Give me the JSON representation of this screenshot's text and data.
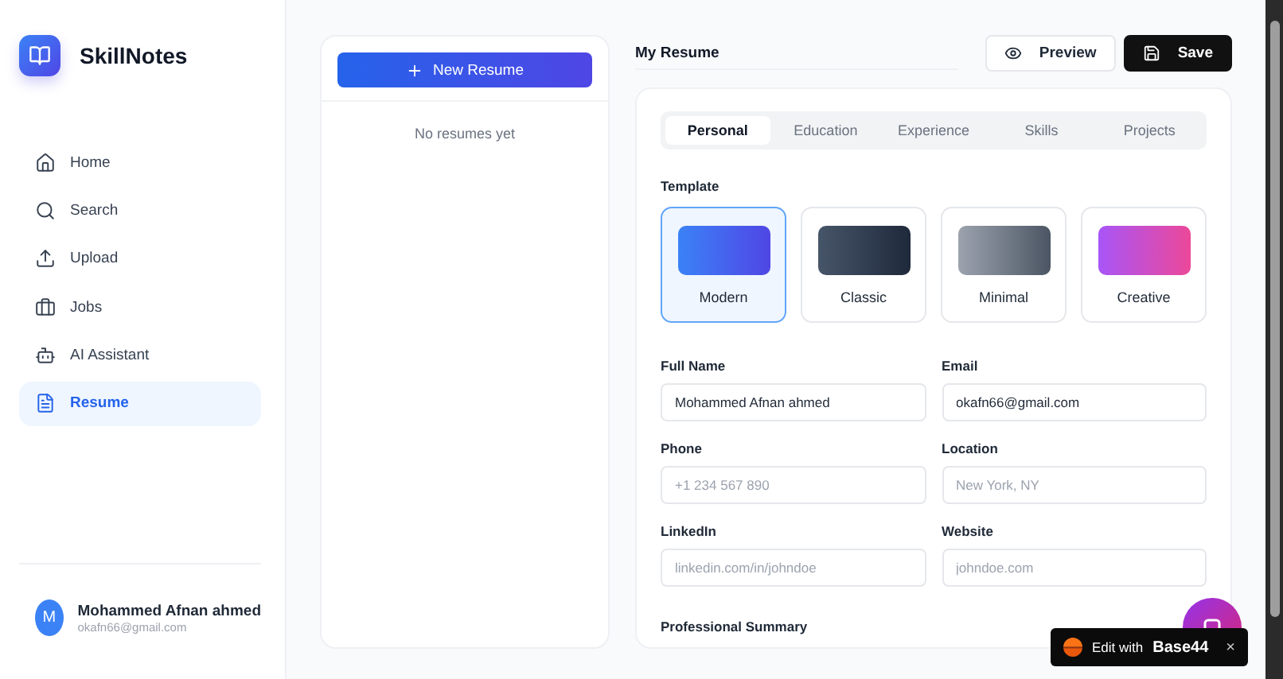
{
  "app": {
    "name": "SkillNotes"
  },
  "nav": [
    {
      "label": "Home",
      "selected": false
    },
    {
      "label": "Search",
      "selected": false
    },
    {
      "label": "Upload",
      "selected": false
    },
    {
      "label": "Jobs",
      "selected": false
    },
    {
      "label": "AI Assistant",
      "selected": false
    },
    {
      "label": "Resume",
      "selected": true
    }
  ],
  "user": {
    "initial": "M",
    "name": "Mohammed Afnan ahmed",
    "email": "okafn66@gmail.com"
  },
  "resume_list": {
    "new_button": "New Resume",
    "empty": "No resumes yet"
  },
  "editor": {
    "title": "My Resume",
    "preview_button": "Preview",
    "save_button": "Save",
    "tabs": [
      {
        "label": "Personal",
        "selected": true
      },
      {
        "label": "Education",
        "selected": false
      },
      {
        "label": "Experience",
        "selected": false
      },
      {
        "label": "Skills",
        "selected": false
      },
      {
        "label": "Projects",
        "selected": false
      }
    ],
    "template_label": "Template",
    "templates": [
      {
        "name": "Modern",
        "selected": true,
        "color": "#3b82f6"
      },
      {
        "name": "Classic",
        "selected": false,
        "color": "#475569"
      },
      {
        "name": "Minimal",
        "selected": false,
        "color": "#9ca3af"
      },
      {
        "name": "Creative",
        "selected": false,
        "color": "#a855f7"
      }
    ],
    "fields": [
      {
        "label": "Full Name",
        "value": "Mohammed Afnan ahmed"
      },
      {
        "label": "Email",
        "value": "okafn66@gmail.com"
      },
      {
        "label": "Phone",
        "placeholder": "+1 234 567 890"
      },
      {
        "label": "Location",
        "placeholder": "New York, NY"
      },
      {
        "label": "LinkedIn",
        "placeholder": "linkedin.com/in/johndoe"
      },
      {
        "label": "Website",
        "placeholder": "johndoe.com"
      }
    ],
    "summary_label": "Professional Summary"
  },
  "badge": {
    "prefix": "Edit with",
    "brand": "Base44",
    "close": "×"
  }
}
